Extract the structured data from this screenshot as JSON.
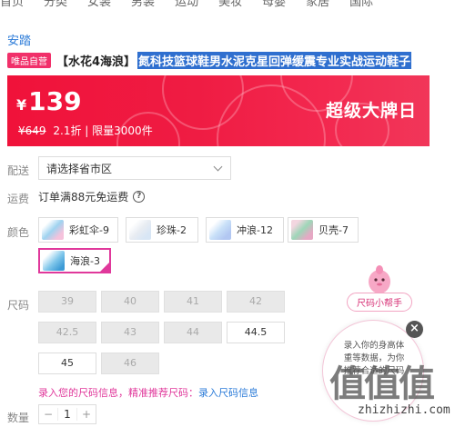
{
  "brand": "安踏",
  "title": {
    "badge": "唯品自营",
    "tag": "【水花4海浪】",
    "text": "氮科技篮球鞋男水泥克星回弹缓震专业实战运动鞋子"
  },
  "price": {
    "currency": "¥",
    "amount": "139",
    "original": "¥649",
    "discount": "2.1折",
    "limit": "| 限量3000件",
    "promo_label": "超级大牌日"
  },
  "delivery": {
    "label": "配送",
    "placeholder": "请选择省市区"
  },
  "shipping": {
    "label": "运费",
    "text": "订单满88元免运费",
    "help": "?"
  },
  "colors": {
    "label": "颜色",
    "items": [
      {
        "name": "彩虹伞-9",
        "thumb": "#9fd3f0"
      },
      {
        "name": "珍珠-2",
        "thumb": "#e8ecf2"
      },
      {
        "name": "冲浪-12",
        "thumb": "#c8e0f8"
      },
      {
        "name": "贝壳-7",
        "thumb": "#9ed6b8"
      },
      {
        "name": "海浪-3",
        "thumb": "#7fc6ea",
        "selected": true
      }
    ]
  },
  "sizes": {
    "label": "尺码",
    "items": [
      {
        "size": "39",
        "available": false
      },
      {
        "size": "40",
        "available": false
      },
      {
        "size": "41",
        "available": false
      },
      {
        "size": "42",
        "available": false
      },
      {
        "size": "42.5",
        "available": false
      },
      {
        "size": "43",
        "available": false
      },
      {
        "size": "44",
        "available": false
      },
      {
        "size": "44.5",
        "available": true
      },
      {
        "size": "45",
        "available": true
      },
      {
        "size": "46",
        "available": false
      }
    ],
    "note": "录入您的尺码信息，精准推荐尺码：",
    "note_link": "录入尺码信息"
  },
  "quantity": {
    "label": "数量",
    "value": "1",
    "minus": "−",
    "plus": "+"
  },
  "helper": {
    "pill": "尺码小帮手",
    "text": "录入你的身高体重等数据，为你推荐合适的尺码",
    "close": "×"
  },
  "watermark": {
    "big": "值值值",
    "url": "zhizhizhi.com"
  },
  "colors_theme": {
    "accent": "#e0389b",
    "banner": "#f0123a",
    "link": "#2b7bd8"
  }
}
